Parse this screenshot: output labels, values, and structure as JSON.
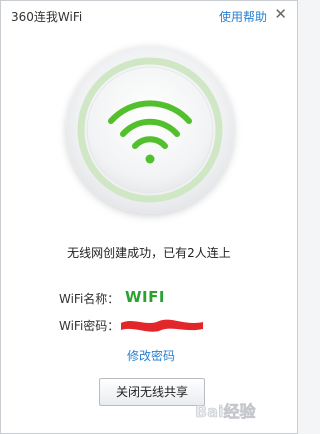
{
  "window": {
    "title": "360连我WiFi",
    "help_label": "使用帮助",
    "close_glyph": "✕"
  },
  "status": {
    "message": "无线网创建成功，已有2人连上"
  },
  "wifi": {
    "name_label": "WiFi名称：",
    "name_value": "WIFI",
    "password_label": "WiFi密码：",
    "modify_password_label": "修改密码"
  },
  "actions": {
    "close_share_label": "关闭无线共享"
  },
  "watermark": {
    "text": "Bai经验"
  },
  "colors": {
    "wifi_green": "#52c02d",
    "link_blue": "#2a7fd0",
    "ssid_green": "#2aa232",
    "redaction_red": "#e3262a"
  },
  "icons": {
    "hero": "wifi-icon",
    "close": "close-icon"
  }
}
